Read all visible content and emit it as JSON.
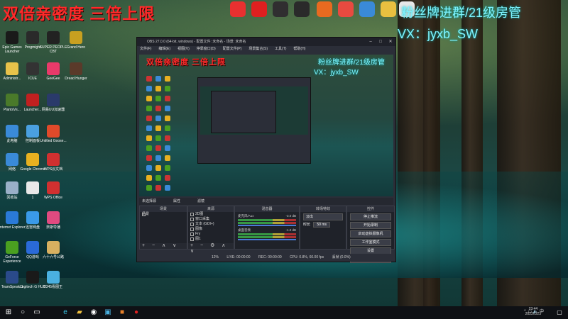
{
  "overlay": {
    "red_text": "双倍亲密度 三倍上限",
    "cyan_line1": "粉丝牌进群/21级房管",
    "cyan_line2": "VX：jyxb_SW"
  },
  "desktop_icons": [
    {
      "label": "Epic Games Launcher",
      "color": "#1a1a1a"
    },
    {
      "label": "Progmight",
      "color": "#2a2a2a"
    },
    {
      "label": "SUPER PEOPLE CBT",
      "color": "#222"
    },
    {
      "label": "Grand Hero",
      "color": "#c8a020"
    },
    {
      "label": "Administr...",
      "color": "#e8c24a"
    },
    {
      "label": "ICUE",
      "color": "#333"
    },
    {
      "label": "GeeGee",
      "color": "#e83a6a"
    },
    {
      "label": "Dread Hunger",
      "color": "#5a3a2a"
    },
    {
      "label": "PlantsVs...",
      "color": "#4a7a2a"
    },
    {
      "label": "Launcher...",
      "color": "#c02020"
    },
    {
      "label": "网易UU加速器",
      "color": "#2a3a6a"
    },
    {
      "label": "此电脑",
      "color": "#3a8ad8"
    },
    {
      "label": "控制面板",
      "color": "#4aa0e0"
    },
    {
      "label": "Untitled Goose...",
      "color": "#e04a2a"
    },
    {
      "label": "网络",
      "color": "#3a8ad8"
    },
    {
      "label": "Google Chrome",
      "color": "#e8b020"
    },
    {
      "label": "WPS云文档",
      "color": "#d03030"
    },
    {
      "label": "回收站",
      "color": "#9ab0c8"
    },
    {
      "label": "1",
      "color": "#e8e8e8"
    },
    {
      "label": "WPS Office",
      "color": "#d03030"
    },
    {
      "label": "Internet Explorer",
      "color": "#2a7ad8"
    },
    {
      "label": "迅雷网盘",
      "color": "#3a9ae8"
    },
    {
      "label": "奈斯导播",
      "color": "#e04a80"
    },
    {
      "label": "GeForce Experience",
      "color": "#4aa020"
    },
    {
      "label": "QQ游戏",
      "color": "#2a6ad8"
    },
    {
      "label": "六十六号公路",
      "color": "#d8b060"
    },
    {
      "label": "TeamSpeak 3",
      "color": "#2a4a8a"
    },
    {
      "label": "Logitech G HUB",
      "color": "#1a1a1a"
    },
    {
      "label": "2345看图王",
      "color": "#4ab0e0"
    }
  ],
  "top_icons": [
    {
      "label": "腾讯QQ",
      "color": "#e83030"
    },
    {
      "label": "网易云音乐",
      "color": "#e02020"
    },
    {
      "label": "OBS",
      "color": "#302e30"
    },
    {
      "label": "腾讯TIM",
      "color": "#2a2a2a"
    },
    {
      "label": "火绒安全",
      "color": "#e86a20"
    },
    {
      "label": "QQ飞车",
      "color": "#e84a40"
    },
    {
      "label": "金山",
      "color": "#3a8ad8"
    },
    {
      "label": "微信",
      "color": "#e8c040"
    },
    {
      "label": "Chrome",
      "color": "#e8e8e8"
    }
  ],
  "obs": {
    "title": "OBS 27.0.0 (64-bit, windows) - 配置文件: 未命名 - 场景: 未命名",
    "menu": [
      "文件(F)",
      "编辑(E)",
      "视图(V)",
      "停靠窗口(D)",
      "配置文件(P)",
      "场景集合(S)",
      "工具(T)",
      "帮助(H)"
    ],
    "dock_tabs": [
      "未选择源",
      "属性",
      "滤镜"
    ],
    "scenes_header": "场景",
    "scenes": [
      "场景"
    ],
    "sources_header": "来源",
    "sources": [
      "2D图",
      "窗口采集",
      "文本 (GDI+)",
      "图像",
      "Fry",
      "图1"
    ],
    "mixer_header": "混音器",
    "mixer": [
      {
        "name": "麦克风/Aux",
        "db": "-3.0 dB"
      },
      {
        "name": "桌面音频",
        "db": "-1.0 dB"
      }
    ],
    "transitions_header": "转场特效",
    "transition_type": "淡出",
    "duration_label": "时长",
    "duration_value": "50 ms",
    "controls_header": "控件",
    "controls": [
      "停止推流",
      "开始录制",
      "启动虚拟摄像机",
      "工作室模式",
      "设置",
      "退出"
    ],
    "status": {
      "live": "LIVE: 00:00:00",
      "rec": "REC: 00:00:00",
      "cpu": "CPU: 0.8%, 60.00 fps",
      "dropped": "丢帧 (0.0%)",
      "kbps": "12%"
    }
  },
  "taskbar": {
    "time": "23:44",
    "date": "2022/1/23",
    "lang": "中"
  }
}
